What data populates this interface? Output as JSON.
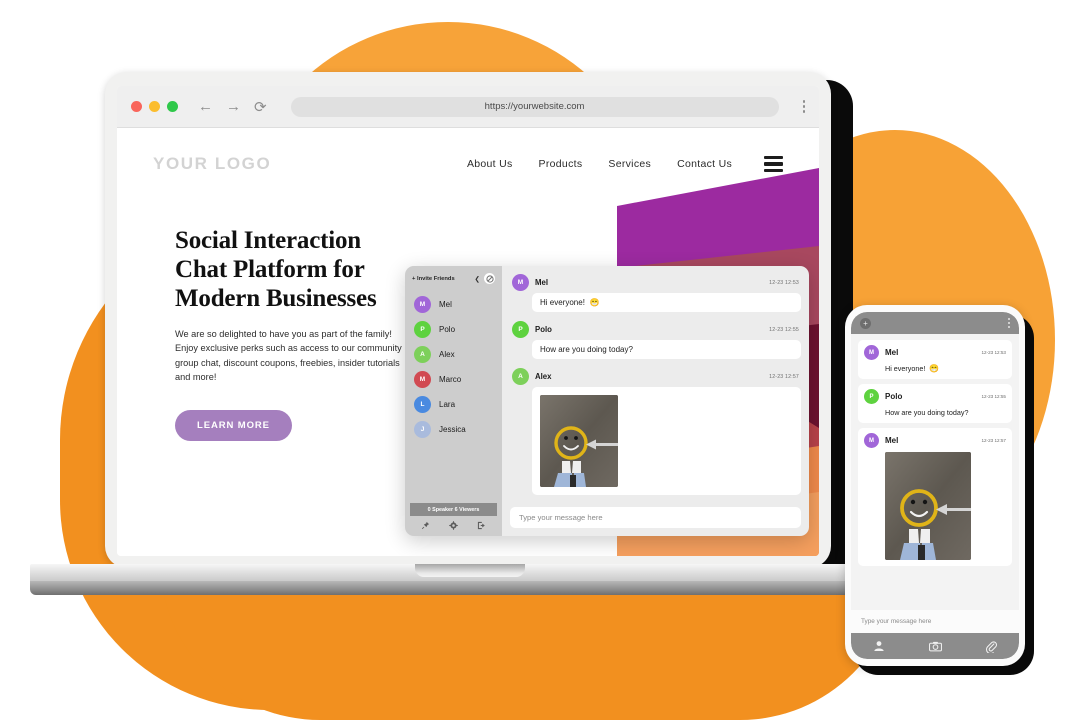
{
  "browser": {
    "url": "https://yourwebsite.com",
    "back_icon": "back-arrow-icon",
    "forward_icon": "forward-arrow-icon",
    "reload_icon": "reload-icon",
    "menu_icon": "kebab-menu-icon"
  },
  "site": {
    "logo": "YOUR LOGO",
    "nav": [
      {
        "label": "About Us"
      },
      {
        "label": "Products"
      },
      {
        "label": "Services"
      },
      {
        "label": "Contact Us"
      }
    ],
    "hero": {
      "heading": "Social Interaction Chat Platform for Modern Businesses",
      "body": "We are so delighted to have you as part of the family! Enjoy exclusive perks such as access to our community group chat, discount coupons, freebies, insider tutorials and more!",
      "cta_label": "LEARN MORE",
      "cta_color": "#a57fbe"
    }
  },
  "chat": {
    "sidebar": {
      "invite_label": "+ Invite Friends",
      "collapse_icon": "chevron-left-icon",
      "mute_icon": "no-sign-icon",
      "friends": [
        {
          "initial": "M",
          "name": "Mel",
          "color": "#a166d8"
        },
        {
          "initial": "P",
          "name": "Polo",
          "color": "#5ed23f"
        },
        {
          "initial": "A",
          "name": "Alex",
          "color": "#7dd05a"
        },
        {
          "initial": "M",
          "name": "Marco",
          "color": "#d14a52"
        },
        {
          "initial": "L",
          "name": "Lara",
          "color": "#4a8ae0"
        },
        {
          "initial": "J",
          "name": "Jessica",
          "color": "#a9bbdd"
        }
      ],
      "status": "0 Speaker 6 Viewers",
      "tools": [
        {
          "icon": "pin-icon"
        },
        {
          "icon": "gear-icon"
        },
        {
          "icon": "exit-icon"
        }
      ]
    },
    "messages": [
      {
        "initial": "M",
        "name": "Mel",
        "color": "#a166d8",
        "time": "12-23 12:53",
        "text": "Hi everyone!",
        "emoji": "😁",
        "type": "text"
      },
      {
        "initial": "P",
        "name": "Polo",
        "color": "#5ed23f",
        "time": "12-23 12:55",
        "text": "How are you doing today?",
        "type": "text"
      },
      {
        "initial": "A",
        "name": "Alex",
        "color": "#7dd05a",
        "time": "12-23 12:57",
        "type": "image",
        "image_alt": "photo-feet-smiley-arrow-asphalt"
      }
    ],
    "composer_placeholder": "Type your message here"
  },
  "phone": {
    "add_icon": "plus-circle-icon",
    "menu_icon": "kebab-menu-icon",
    "messages": [
      {
        "initial": "M",
        "name": "Mel",
        "color": "#a166d8",
        "time": "12-23 12:53",
        "text": "Hi everyone!",
        "emoji": "😁",
        "type": "text"
      },
      {
        "initial": "P",
        "name": "Polo",
        "color": "#5ed23f",
        "time": "12-23 12:55",
        "text": "How are you doing today?",
        "type": "text"
      },
      {
        "initial": "M",
        "name": "Mel",
        "color": "#a166d8",
        "time": "12-23 12:57",
        "type": "image",
        "image_alt": "photo-feet-smiley-arrow-asphalt"
      }
    ],
    "composer_placeholder": "Type your message here",
    "tabs": [
      {
        "icon": "person-icon"
      },
      {
        "icon": "camera-icon"
      },
      {
        "icon": "paperclip-icon"
      }
    ]
  }
}
